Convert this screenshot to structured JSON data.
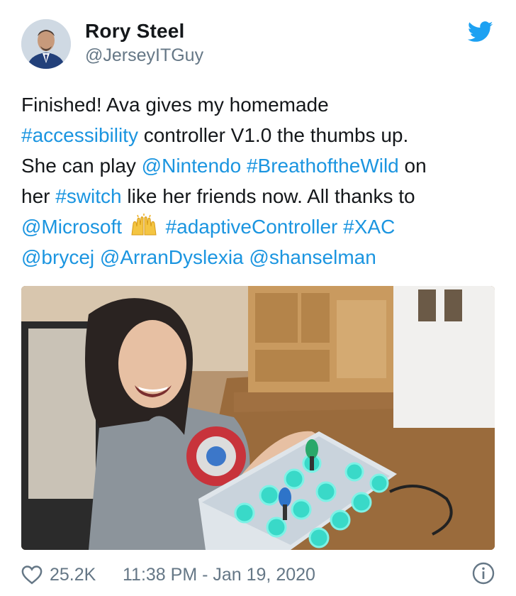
{
  "author": {
    "display_name": "Rory Steel",
    "handle": "@JerseyITGuy"
  },
  "tweet": {
    "lines": [
      [
        {
          "t": "Finished! Ava gives my homemade"
        }
      ],
      [
        {
          "t": "#accessibility",
          "link": true
        },
        {
          "t": " controller V1.0 the thumbs up."
        }
      ],
      [
        {
          "t": "She can play "
        },
        {
          "t": "@Nintendo",
          "link": true
        },
        {
          "t": " "
        },
        {
          "t": "#BreathoftheWild",
          "link": true
        },
        {
          "t": " on"
        }
      ],
      [
        {
          "t": "her "
        },
        {
          "t": "#switch",
          "link": true
        },
        {
          "t": " like her friends now. All thanks to"
        }
      ],
      [
        {
          "t": "@Microsoft",
          "link": true
        },
        {
          "t": " "
        },
        {
          "emoji": "raising-hands-emoji"
        },
        {
          "t": " "
        },
        {
          "t": "#adaptiveController",
          "link": true
        },
        {
          "t": " "
        },
        {
          "t": "#XAC",
          "link": true
        }
      ],
      [
        {
          "t": "@brycej",
          "link": true
        },
        {
          "t": " "
        },
        {
          "t": "@ArranDyslexia",
          "link": true
        },
        {
          "t": " "
        },
        {
          "t": "@shanselman",
          "link": true
        }
      ]
    ]
  },
  "footer": {
    "likes": "25.2K",
    "timestamp": "11:38 PM - Jan 19, 2020"
  },
  "icons": {
    "brand": "twitter-bird-icon",
    "like": "heart-icon",
    "info": "info-icon"
  },
  "colors": {
    "link": "#1b95e0",
    "text": "#14171a",
    "secondary": "#657786"
  }
}
